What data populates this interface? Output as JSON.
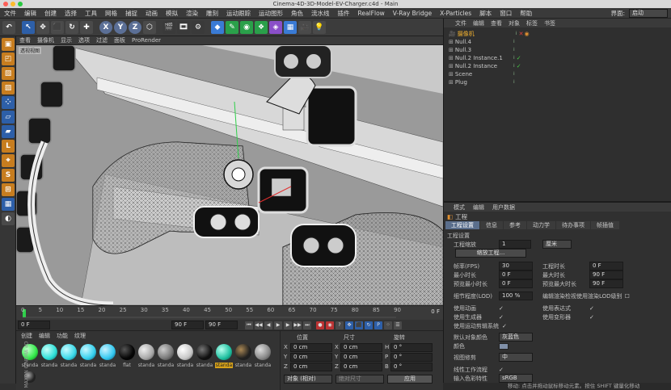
{
  "window": {
    "title": "Cinema-4D-3D-Model-EV-Charger.c4d - Main"
  },
  "menubar": {
    "items": [
      "文件",
      "编辑",
      "创建",
      "选择",
      "工具",
      "网格",
      "捕捉",
      "动画",
      "模拟",
      "渲染",
      "雕刻",
      "运动跟踪",
      "运动图形",
      "角色",
      "流水线",
      "插件",
      "RealFlow",
      "V-Ray Bridge",
      "X-Particles",
      "脚本",
      "窗口",
      "帮助"
    ],
    "layout_label": "界面:",
    "layout_value": "启动"
  },
  "toolbar": {
    "axis_x": "X",
    "axis_y": "Y",
    "axis_z": "Z"
  },
  "viewport": {
    "menu": [
      "查看",
      "摄像机",
      "显示",
      "选项",
      "过滤",
      "面板",
      "ProRender"
    ],
    "label": "透视视图"
  },
  "timeline": {
    "ticks": [
      "0",
      "5",
      "10",
      "15",
      "20",
      "25",
      "30",
      "35",
      "40",
      "45",
      "50",
      "55",
      "60",
      "65",
      "70",
      "75",
      "80",
      "85",
      "90"
    ],
    "current": "0 F",
    "end_frame": "90 F"
  },
  "transport": {
    "start_field": "0 F",
    "end_field": "90 F",
    "end_field2": "90 F"
  },
  "material_panel": {
    "menu": [
      "创建",
      "编辑",
      "功能",
      "纹理"
    ],
    "materials": [
      {
        "label": "standa",
        "color": "#33e84a"
      },
      {
        "label": "standa",
        "color": "#2ee0d8"
      },
      {
        "label": "standa",
        "color": "#3ad8e8"
      },
      {
        "label": "standa",
        "color": "#35d0ee"
      },
      {
        "label": "standa",
        "color": "#33c8f0"
      },
      {
        "label": "flat",
        "color": "#050505"
      },
      {
        "label": "standa",
        "color": "#a8a8a8"
      },
      {
        "label": "standa",
        "color": "#787878"
      },
      {
        "label": "standa",
        "color": "#c8c8c8"
      },
      {
        "label": "standa",
        "color": "#101010"
      },
      {
        "label": "standa",
        "color": "#1fc0a0"
      },
      {
        "label": "standa",
        "color": "#202020"
      },
      {
        "label": "standa",
        "color": "#888888"
      }
    ],
    "brand": "MAXON CINEMA 4D"
  },
  "coordinates": {
    "headers": [
      "位置",
      "尺寸",
      "旋转"
    ],
    "rows": [
      {
        "axis": "X",
        "pos": "0 cm",
        "size_axis": "X",
        "size": "0 cm",
        "rot_axis": "H",
        "rot": "0 °"
      },
      {
        "axis": "Y",
        "pos": "0 cm",
        "size_axis": "Y",
        "size": "0 cm",
        "rot_axis": "P",
        "rot": "0 °"
      },
      {
        "axis": "Z",
        "pos": "0 cm",
        "size_axis": "Z",
        "size": "0 cm",
        "rot_axis": "B",
        "rot": "0 °"
      }
    ],
    "mode_select": "对象 (相对)",
    "size_select": "绝对尺寸",
    "apply_button": "应用"
  },
  "object_manager": {
    "menu": [
      "文件",
      "编辑",
      "查看",
      "对象",
      "标签",
      "书签"
    ],
    "objects": [
      "摄像机",
      "Null.4",
      "Null.3",
      "Null.2 Instance.1",
      "Null.2 Instance",
      "Scene",
      "Plug"
    ]
  },
  "attribute_manager": {
    "menu": [
      "模式",
      "编辑",
      "用户数据"
    ],
    "title": "工程",
    "tabs": [
      "工程设置",
      "信息",
      "参考",
      "动力学",
      "待办事项",
      "帧插值"
    ],
    "section": "工程设置",
    "scale_label": "工程缩放",
    "scale_value": "1",
    "scale_unit": "厘米",
    "scale_button": "缩放工程...",
    "fps_label": "帧率(FPS)",
    "fps_value": "30",
    "project_time_label": "工程时长",
    "project_time_value": "0 F",
    "min_time_label": "最小时长",
    "min_time_value": "0 F",
    "max_time_label": "最大时长",
    "max_time_value": "90 F",
    "preview_min_label": "预览最小时长",
    "preview_min_value": "0 F",
    "preview_max_label": "预览最大时长",
    "preview_max_value": "90 F",
    "lod_label": "细节程度(LOD)",
    "lod_value": "100 %",
    "lod_check_label": "编辑渲染检视使用渲染LOD级别",
    "use_animation": "使用动画",
    "use_expression": "使用表达式",
    "use_generator": "使用生成器",
    "use_deformer": "使用变形器",
    "use_motion_system": "使用运动剪辑系统",
    "default_color_label": "默认对象颜色",
    "default_color_value": "灰蓝色",
    "color_label": "颜色",
    "view_clip_label": "视图修剪",
    "view_clip_value": "中",
    "linear_workflow": "线性工作流程",
    "input_color_label": "输入色彩特性",
    "input_color_value": "sRGB"
  },
  "status": {
    "text": "移动: 点击并拖动鼠标移动元素。按住 SHIFT 键量化移动"
  },
  "colors": {
    "accent": "#5a6e8c",
    "panel": "#303030",
    "viewport": "#8a8a8a"
  }
}
